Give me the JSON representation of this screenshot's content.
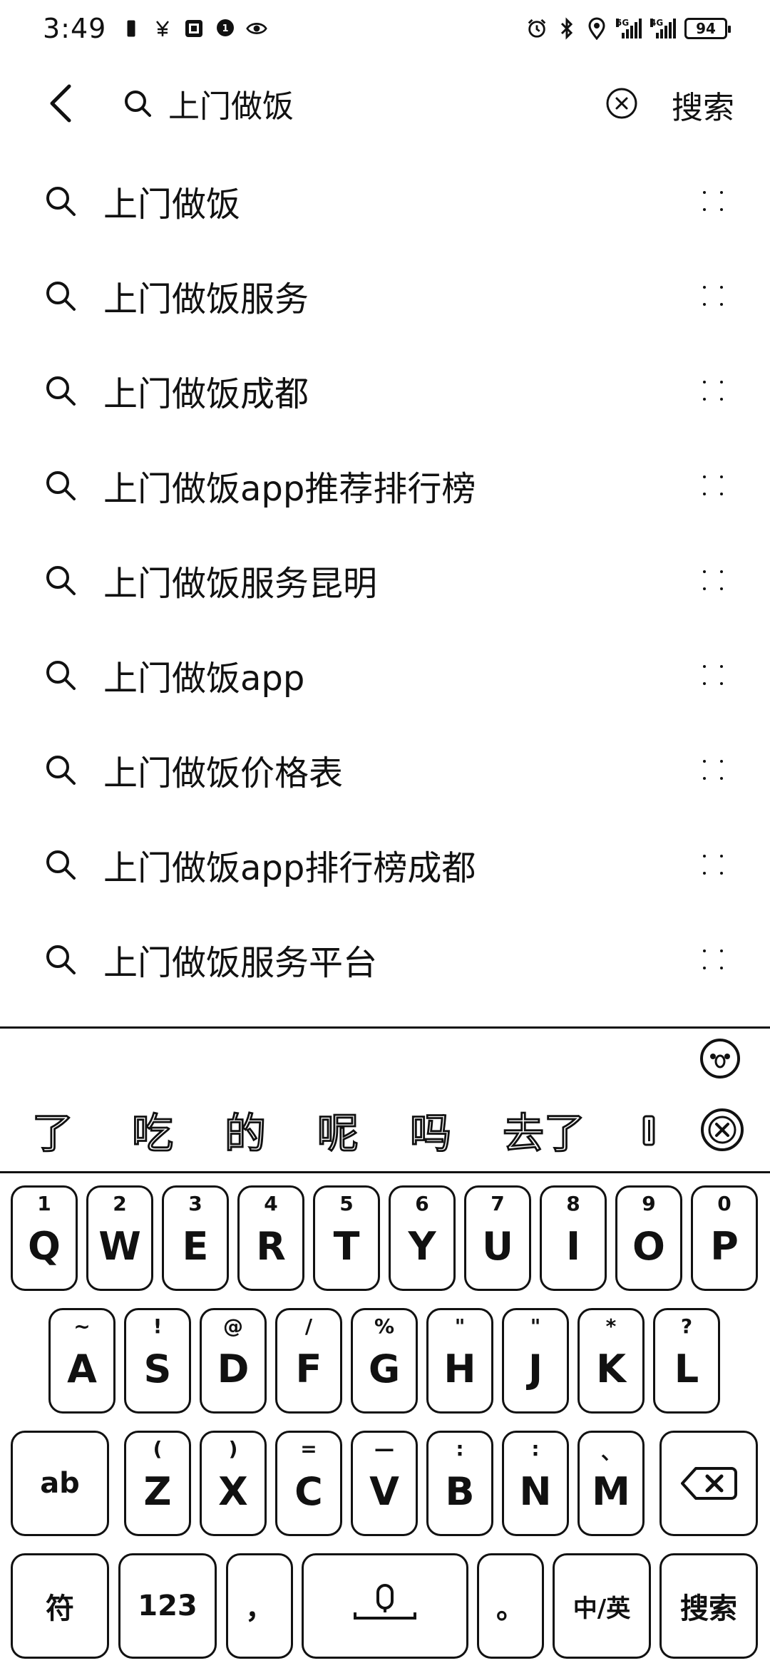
{
  "status_bar": {
    "time": "3:49",
    "left_icons": [
      "sim-icon",
      "yuan-icon",
      "app-icon",
      "chat-icon",
      "eye-icon"
    ],
    "right_icons": [
      "alarm-icon",
      "bluetooth-icon",
      "location-icon",
      "signal-5g-icon",
      "signal-4g-icon"
    ],
    "signal_5g_label": "5G",
    "signal_4g_label": "4G",
    "battery_level": "94"
  },
  "search": {
    "query": "上门做饭",
    "search_button_label": "搜索"
  },
  "suggestions": [
    "上门做饭",
    "上门做饭服务",
    "上门做饭成都",
    "上门做饭app推荐排行榜",
    "上门做饭服务昆明",
    "上门做饭app",
    "上门做饭价格表",
    "上门做饭app排行榜成都",
    "上门做饭服务平台"
  ],
  "ime": {
    "candidates": [
      "了",
      "吃",
      "的",
      "呢",
      "吗",
      "去了"
    ],
    "keyboard": {
      "row1": [
        {
          "main": "Q",
          "sub": "1"
        },
        {
          "main": "W",
          "sub": "2"
        },
        {
          "main": "E",
          "sub": "3"
        },
        {
          "main": "R",
          "sub": "4"
        },
        {
          "main": "T",
          "sub": "5"
        },
        {
          "main": "Y",
          "sub": "6"
        },
        {
          "main": "U",
          "sub": "7"
        },
        {
          "main": "I",
          "sub": "8"
        },
        {
          "main": "O",
          "sub": "9"
        },
        {
          "main": "P",
          "sub": "0"
        }
      ],
      "row2": [
        {
          "main": "A",
          "sub": "~"
        },
        {
          "main": "S",
          "sub": "!"
        },
        {
          "main": "D",
          "sub": "@"
        },
        {
          "main": "F",
          "sub": "/"
        },
        {
          "main": "G",
          "sub": "%"
        },
        {
          "main": "H",
          "sub": "\""
        },
        {
          "main": "J",
          "sub": "\""
        },
        {
          "main": "K",
          "sub": "*"
        },
        {
          "main": "L",
          "sub": "?"
        }
      ],
      "row3": [
        {
          "main": "Z",
          "sub": "("
        },
        {
          "main": "X",
          "sub": ")"
        },
        {
          "main": "C",
          "sub": "="
        },
        {
          "main": "V",
          "sub": "—"
        },
        {
          "main": "B",
          "sub": ":"
        },
        {
          "main": "N",
          "sub": ":"
        },
        {
          "main": "M",
          "sub": "、"
        }
      ],
      "shift_label": "ab",
      "symbols_label": "符",
      "numbers_label": "123",
      "comma_label": "，",
      "period_label": "。",
      "lang_label": "中/英",
      "enter_label": "搜索"
    }
  }
}
